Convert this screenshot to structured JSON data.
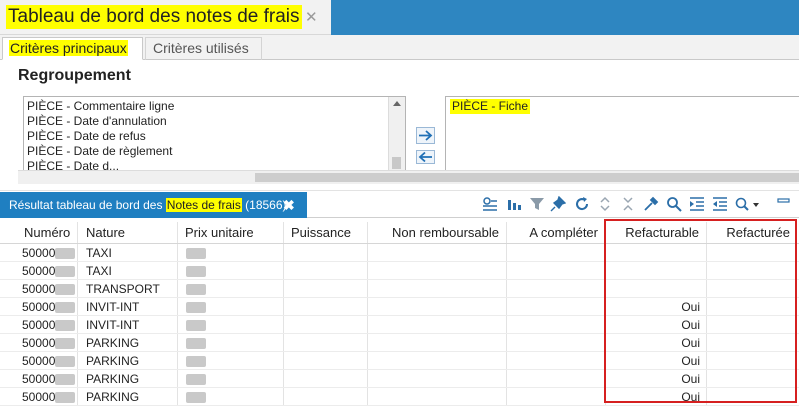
{
  "window": {
    "title": "Tableau de bord des notes de frais",
    "close_glyph": "✕"
  },
  "criteria_tabs": [
    {
      "label": "Critères principaux"
    },
    {
      "label": "Critères utilisés"
    }
  ],
  "grouping": {
    "title": "Regroupement",
    "available": [
      "PIÈCE - Commentaire ligne",
      "PIÈCE - Date d'annulation",
      "PIÈCE - Date de refus",
      "PIÈCE - Date de règlement",
      "PIÈCE - Date d..."
    ],
    "selected": [
      "PIÈCE - Fiche"
    ],
    "move_right": "→",
    "move_left": "←"
  },
  "results": {
    "tab_prefix": "Résultat tableau de bord des ",
    "tab_highlight": "Notes de frais",
    "tab_count": " (18566)",
    "close_glyph": "✖",
    "toolbar_icons": [
      "group-icon",
      "columns-icon",
      "filter-icon",
      "pin-icon",
      "refresh-icon",
      "expand-icon",
      "collapse-icon",
      "pipette-icon",
      "search-icon",
      "indent-icon",
      "outdent-icon",
      "settings-icon",
      "minimize-icon"
    ]
  },
  "table": {
    "columns": [
      "Numéro",
      "Nature",
      "Prix unitaire",
      "Puissance",
      "Non remboursable",
      "A compléter",
      "Refacturable",
      "Refacturée"
    ],
    "rows": [
      {
        "numero": "50000",
        "nature": "TAXI",
        "refacturable": ""
      },
      {
        "numero": "50000",
        "nature": "TAXI",
        "refacturable": ""
      },
      {
        "numero": "50000",
        "nature": "TRANSPORT",
        "refacturable": ""
      },
      {
        "numero": "50000",
        "nature": "INVIT-INT",
        "refacturable": "Oui"
      },
      {
        "numero": "50000",
        "nature": "INVIT-INT",
        "refacturable": "Oui"
      },
      {
        "numero": "50000",
        "nature": "PARKING",
        "refacturable": "Oui"
      },
      {
        "numero": "50000",
        "nature": "PARKING",
        "refacturable": "Oui"
      },
      {
        "numero": "50000",
        "nature": "PARKING",
        "refacturable": "Oui"
      },
      {
        "numero": "50000",
        "nature": "PARKING",
        "refacturable": "Oui"
      }
    ]
  },
  "colors": {
    "accent": "#1f7fc1",
    "highlight": "#ffff00",
    "annotation": "#d62020"
  }
}
